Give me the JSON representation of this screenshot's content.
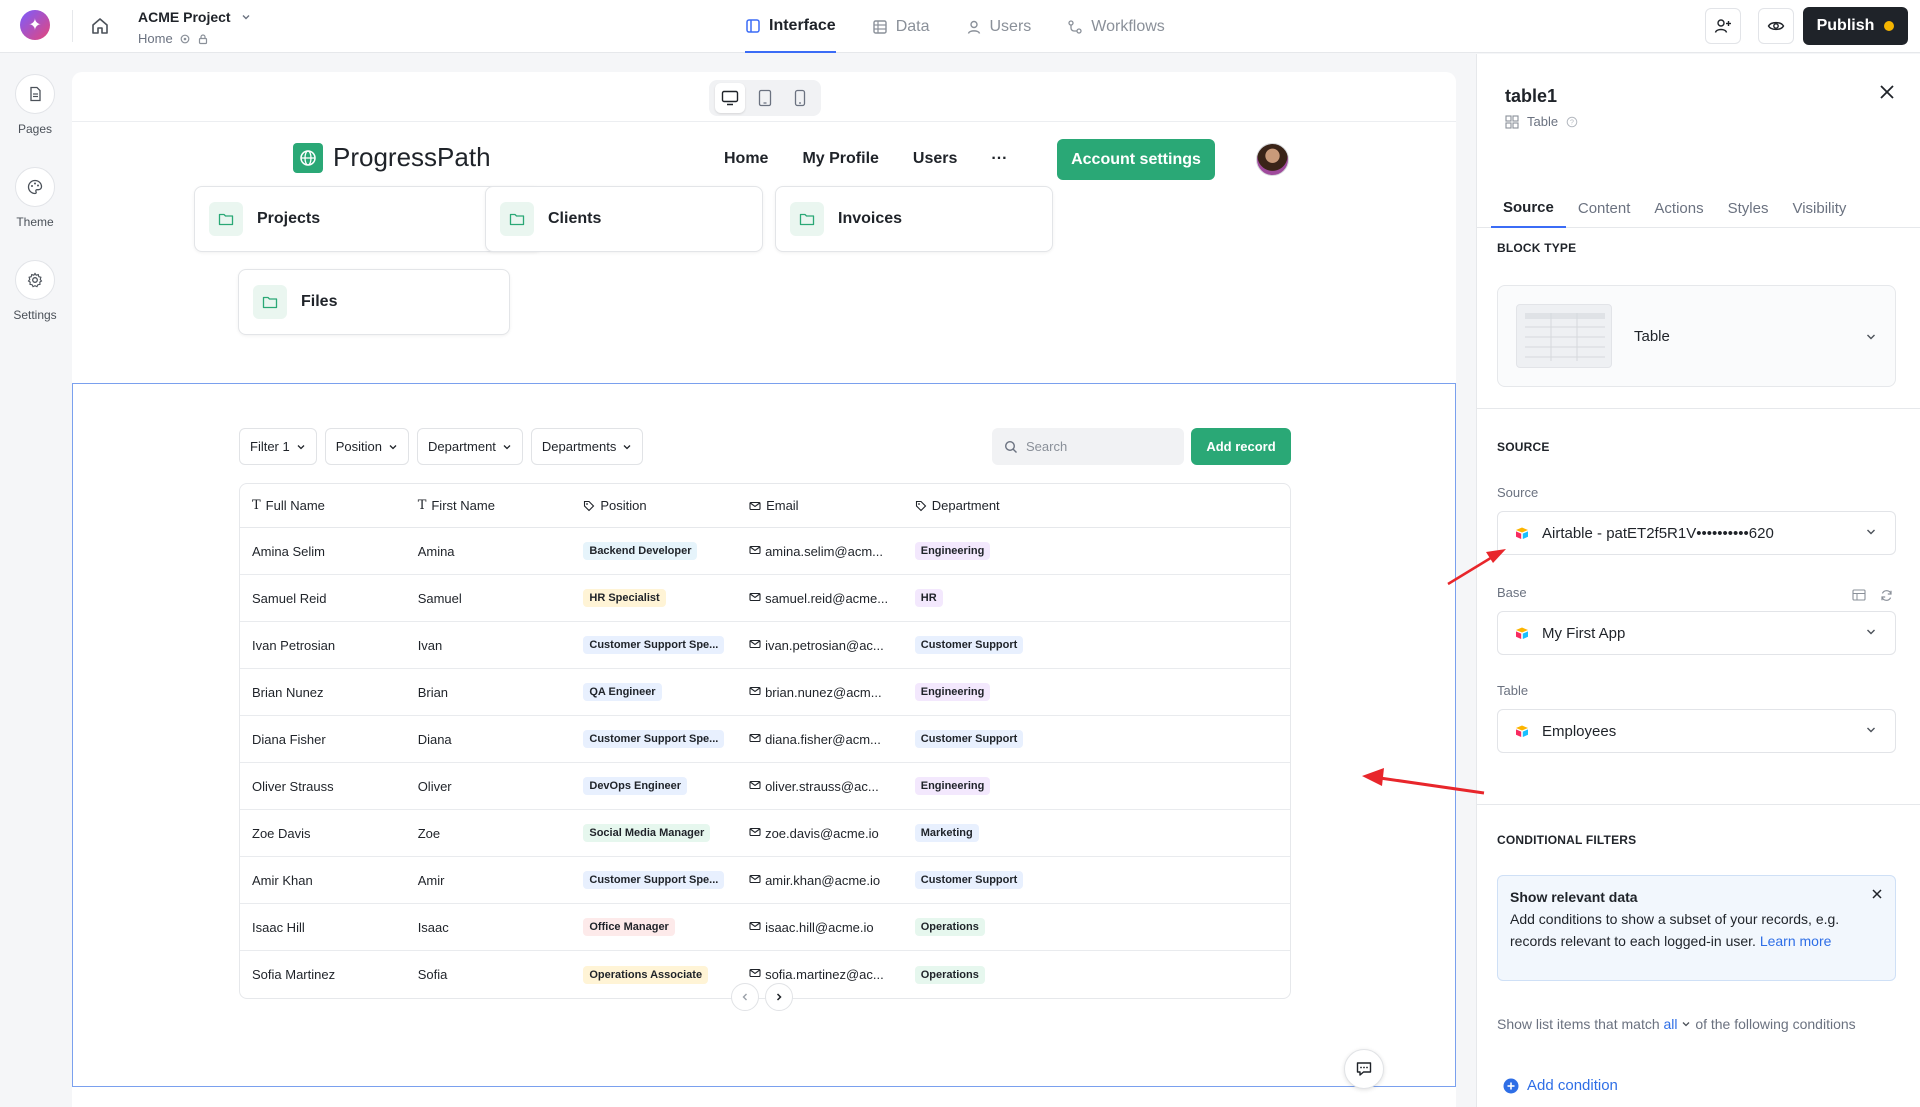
{
  "topbar": {
    "project_name": "ACME Project",
    "page_name": "Home",
    "tabs": [
      {
        "label": "Interface",
        "active": true,
        "icon": "layout-icon"
      },
      {
        "label": "Data",
        "active": false,
        "icon": "grid-icon"
      },
      {
        "label": "Users",
        "active": false,
        "icon": "user-icon"
      },
      {
        "label": "Workflows",
        "active": false,
        "icon": "workflow-icon"
      }
    ],
    "publish_label": "Publish"
  },
  "rail": {
    "items": [
      {
        "label": "Pages",
        "icon": "pages-icon"
      },
      {
        "label": "Theme",
        "icon": "palette-icon"
      },
      {
        "label": "Settings",
        "icon": "gear-icon"
      }
    ]
  },
  "app": {
    "brand": "ProgressPath",
    "nav": [
      "Home",
      "My Profile",
      "Users"
    ],
    "more": "···",
    "account_button": "Account settings"
  },
  "cards": [
    "Projects",
    "Clients",
    "Invoices",
    "Files"
  ],
  "table_block": {
    "filters": [
      "Filter 1",
      "Position",
      "Department",
      "Departments"
    ],
    "search_placeholder": "Search",
    "add_record": "Add record",
    "columns": [
      "Full Name",
      "First Name",
      "Position",
      "Email",
      "Department"
    ],
    "rows": [
      {
        "full": "Amina Selim",
        "first": "Amina",
        "position": "Backend Developer",
        "email": "amina.selim@acm...",
        "dept": "Engineering"
      },
      {
        "full": "Samuel Reid",
        "first": "Samuel",
        "position": "HR Specialist",
        "email": "samuel.reid@acme...",
        "dept": "HR"
      },
      {
        "full": "Ivan Petrosian",
        "first": "Ivan",
        "position": "Customer Support Spe...",
        "email": "ivan.petrosian@ac...",
        "dept": "Customer Support"
      },
      {
        "full": "Brian Nunez",
        "first": "Brian",
        "position": "QA Engineer",
        "email": "brian.nunez@acm...",
        "dept": "Engineering"
      },
      {
        "full": "Diana Fisher",
        "first": "Diana",
        "position": "Customer Support Spe...",
        "email": "diana.fisher@acm...",
        "dept": "Customer Support"
      },
      {
        "full": "Oliver Strauss",
        "first": "Oliver",
        "position": "DevOps Engineer",
        "email": "oliver.strauss@ac...",
        "dept": "Engineering"
      },
      {
        "full": "Zoe Davis",
        "first": "Zoe",
        "position": "Social Media Manager",
        "email": "zoe.davis@acme.io",
        "dept": "Marketing"
      },
      {
        "full": "Amir Khan",
        "first": "Amir",
        "position": "Customer Support Spe...",
        "email": "amir.khan@acme.io",
        "dept": "Customer Support"
      },
      {
        "full": "Isaac Hill",
        "first": "Isaac",
        "position": "Office Manager",
        "email": "isaac.hill@acme.io",
        "dept": "Operations"
      },
      {
        "full": "Sofia Martinez",
        "first": "Sofia",
        "position": "Operations Associate",
        "email": "sofia.martinez@ac...",
        "dept": "Operations"
      }
    ]
  },
  "panel": {
    "title": "table1",
    "subtitle": "Table",
    "tabs": [
      {
        "label": "Source",
        "active": true
      },
      {
        "label": "Content",
        "active": false
      },
      {
        "label": "Actions",
        "active": false
      },
      {
        "label": "Styles",
        "active": false
      },
      {
        "label": "Visibility",
        "active": false
      }
    ],
    "block_type_heading": "BLOCK TYPE",
    "block_type_value": "Table",
    "source_heading": "SOURCE",
    "source_label": "Source",
    "source_value": "Airtable - patET2f5R1V••••••••••620",
    "base_label": "Base",
    "base_value": "My First App",
    "table_label": "Table",
    "table_value": "Employees",
    "cond_heading": "CONDITIONAL FILTERS",
    "info_title": "Show relevant data",
    "info_body": "Add conditions to show a subset of your records, e.g. records relevant to each logged-in user.",
    "info_link": "Learn more",
    "match_prefix": "Show list items that match",
    "match_value": "all",
    "match_suffix": "of the following conditions",
    "add_condition": "Add condition"
  },
  "colors": {
    "accent_green": "#2aa876",
    "accent_blue": "#3b6cf6",
    "annotation_red": "#e8262b",
    "tag_palette": [
      "#e8f0fe",
      "#fdeaea",
      "#fff4d6",
      "#e6f7ee",
      "#f3e8fd",
      "#fde8f3",
      "#e6f4fb"
    ]
  }
}
